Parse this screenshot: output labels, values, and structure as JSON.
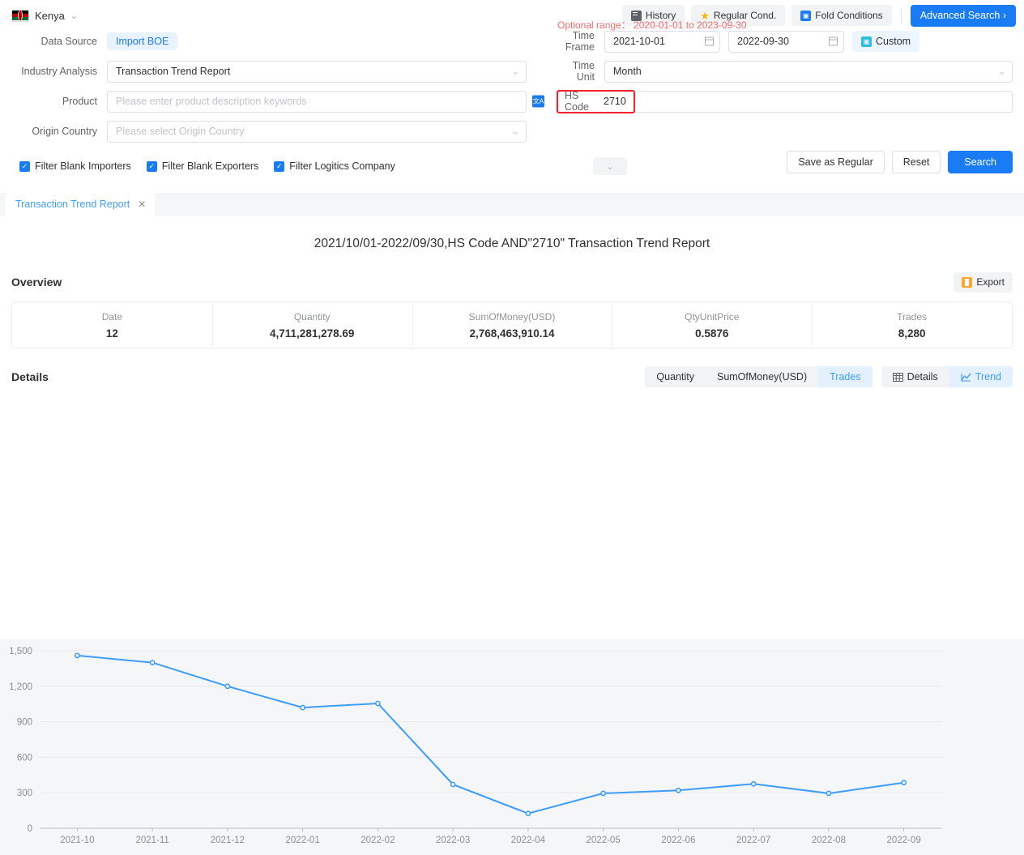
{
  "topbar": {
    "country": "Kenya",
    "buttons": [
      {
        "label": "History",
        "icon": "history-icon"
      },
      {
        "label": "Regular Cond.",
        "icon": "star-icon"
      },
      {
        "label": "Fold Conditions",
        "icon": "fold-icon"
      }
    ],
    "advanced_search": "Advanced Search  ›"
  },
  "form": {
    "data_source_label": "Data Source",
    "data_source_value": "Import BOE",
    "industry_label": "Industry Analysis",
    "industry_value": "Transaction Trend Report",
    "product_label": "Product",
    "product_placeholder": "Please enter product description keywords",
    "product_value": "",
    "origin_label": "Origin Country",
    "origin_placeholder": "Please select Origin Country",
    "origin_value": "",
    "optional_range": "Optional range： 2020-01-01 to 2023-09-30",
    "time_frame_label": "Time Frame",
    "date_from": "2021-10-01",
    "date_to": "2022-09-30",
    "custom_label": "Custom",
    "time_unit_label": "Time Unit",
    "time_unit_value": "Month",
    "hs_code_label": "HS Code",
    "hs_code_value": "2710",
    "checkboxes": [
      {
        "label": "Filter Blank Importers",
        "checked": true
      },
      {
        "label": "Filter Blank Exporters",
        "checked": true
      },
      {
        "label": "Filter Logitics Company",
        "checked": true
      }
    ],
    "save_as_regular": "Save as Regular",
    "reset": "Reset",
    "search": "Search"
  },
  "tabs": [
    {
      "label": "Transaction Trend Report",
      "active": true
    }
  ],
  "report": {
    "title": "2021/10/01-2022/09/30,HS Code AND\"2710\" Transaction Trend Report",
    "overview_title": "Overview",
    "export_label": "Export",
    "overview": [
      {
        "key": "Date",
        "value": "12"
      },
      {
        "key": "Quantity",
        "value": "4,711,281,278.69"
      },
      {
        "key": "SumOfMoney(USD)",
        "value": "2,768,463,910.14"
      },
      {
        "key": "QtyUnitPrice",
        "value": "0.5876"
      },
      {
        "key": "Trades",
        "value": "8,280"
      }
    ],
    "details_title": "Details",
    "metric_tabs": [
      {
        "label": "Quantity",
        "active": false
      },
      {
        "label": "SumOfMoney(USD)",
        "active": false
      },
      {
        "label": "Trades",
        "active": true
      }
    ],
    "view_tabs": [
      {
        "label": "Details",
        "active": false,
        "icon": "table-icon"
      },
      {
        "label": "Trend",
        "active": true,
        "icon": "line-chart-icon"
      }
    ]
  },
  "colors": {
    "primary": "#1a7cf5",
    "line": "#3e9dfb",
    "danger": "#f5222d",
    "warning": "#f56c6c"
  },
  "chart_data": {
    "type": "line",
    "title": "",
    "xlabel": "",
    "ylabel": "",
    "categories": [
      "2021-10",
      "2021-11",
      "2021-12",
      "2022-01",
      "2022-02",
      "2022-03",
      "2022-04",
      "2022-05",
      "2022-06",
      "2022-07",
      "2022-08",
      "2022-09"
    ],
    "series": [
      {
        "name": "Trades",
        "values": [
          1460,
          1400,
          1200,
          1020,
          1055,
          370,
          125,
          295,
          320,
          375,
          295,
          385
        ]
      }
    ],
    "ylim": [
      0,
      1500
    ],
    "yticks": [
      0,
      300,
      600,
      900,
      1200,
      1500
    ],
    "ytick_labels": [
      "0",
      "300",
      "600",
      "900",
      "1,200",
      "1,500"
    ],
    "grid": true,
    "legend": "none"
  }
}
